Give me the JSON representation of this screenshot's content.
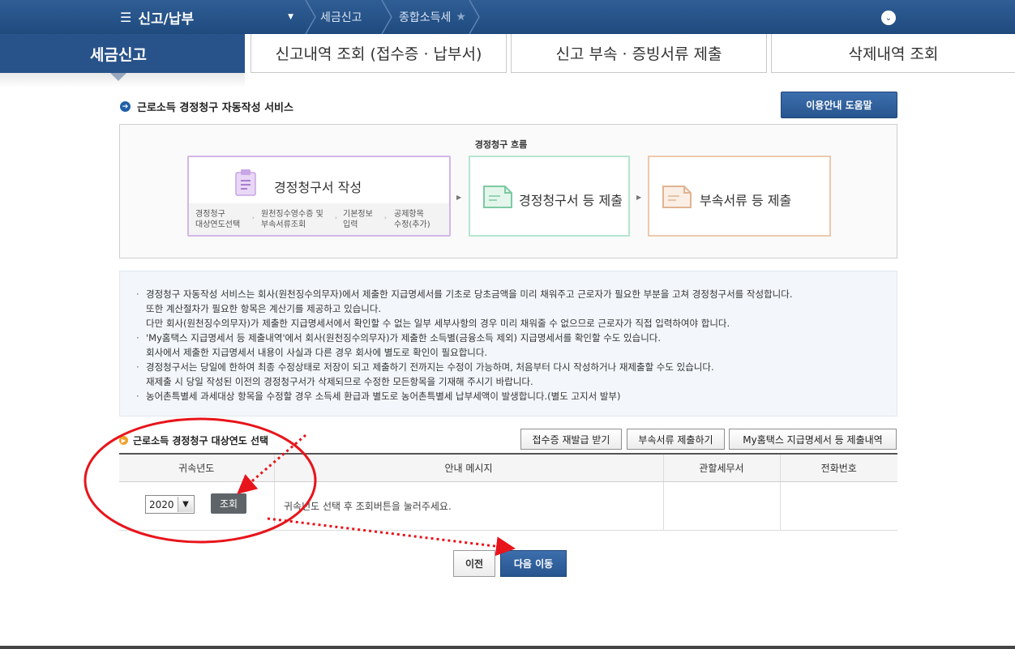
{
  "nav": {
    "menu_label": "신고/납부",
    "breadcrumbs": [
      "세금신고",
      "종합소득세"
    ]
  },
  "tabs": [
    {
      "label": "세금신고",
      "active": true
    },
    {
      "label": "신고내역 조회 (접수증 · 납부서)"
    },
    {
      "label": "신고 부속 · 증빙서류 제출"
    },
    {
      "label": "삭제내역 조회"
    }
  ],
  "section": {
    "title": "근로소득 경정청구 자동작성 서비스",
    "help_button": "이용안내 도움말"
  },
  "flow": {
    "label": "경정청구 흐름",
    "step1": {
      "title": "경정청구서 작성",
      "substeps": [
        [
          "경정청구",
          "대상연도선택"
        ],
        [
          "원천징수영수증 및",
          "부속서류조회"
        ],
        [
          "기본정보",
          "입력"
        ],
        [
          "공제항목",
          "수정(추가)"
        ]
      ]
    },
    "step2": {
      "title": "경정청구서 등 제출"
    },
    "step3": {
      "title": "부속서류 등 제출"
    }
  },
  "notice": [
    {
      "text": "경정청구 자동작성 서비스는 회사(원천징수의무자)에서 제출한 지급명세서를 기초로 당초금액을 미리 채워주고 근로자가 필요한 부분을 고쳐 경정청구서를 작성합니다.",
      "cont": false
    },
    {
      "text": "또한 계산절차가 필요한 항목은 계산기를 제공하고 있습니다.",
      "cont": true
    },
    {
      "text": "다만 회사(원천징수의무자)가 제출한 지급명세서에서 확인할 수 없는 일부 세부사항의 경우 미리 채워줄 수 없으므로 근로자가 직접 입력하여야 합니다.",
      "cont": true
    },
    {
      "text": "'My홈택스 지급명세서 등 제출내역'에서 회사(원천징수의무자)가 제출한 소득별(금융소득 제외) 지급명세서를 확인할 수도 있습니다.",
      "cont": false
    },
    {
      "text": "회사에서 제출한 지급명세서 내용이 사실과 다른 경우 회사에 별도로 확인이 필요합니다.",
      "cont": true
    },
    {
      "text": "경정청구서는 당일에 한하여 최종 수정상태로 저장이 되고 제출하기 전까지는 수정이 가능하며, 처음부터 다시 작성하거나 재제출할 수도 있습니다.",
      "cont": false
    },
    {
      "text": "재제출 시 당일 작성된 이전의 경정청구서가 삭제되므로 수정한 모든항목을 기재해 주시기 바랍니다.",
      "cont": true
    },
    {
      "text": "농어촌특별세 과세대상 항목을 수정할 경우 소득세 환급과 별도로 농어촌특별세 납부세액이 발생합니다.(별도 고지서 발부)",
      "cont": false
    }
  ],
  "year_section": {
    "title": "근로소득 경정청구 대상연도 선택",
    "buttons": [
      "접수증 재발급 받기",
      "부속서류 제출하기",
      "My홈택스 지급명세서 등 제출내역"
    ],
    "table_headers": [
      "귀속년도",
      "안내 메시지",
      "관할세무서",
      "전화번호"
    ],
    "year_value": "2020",
    "query_button": "조회",
    "message": "귀속년도 선택 후 조회버튼을 눌러주세요."
  },
  "footer": {
    "prev_button": "이전",
    "next_button": "다음 이동"
  },
  "colors": {
    "nav_bg": "#1f4a7e",
    "active_tab": "#28528a",
    "annotation_red": "#e8141b"
  }
}
